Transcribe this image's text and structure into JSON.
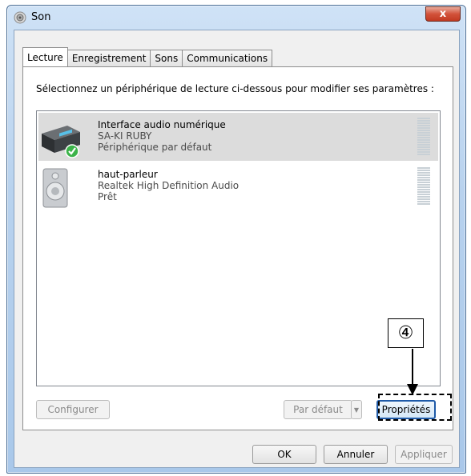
{
  "window": {
    "title": "Son",
    "close_label": "x"
  },
  "tabs": [
    {
      "label": "Lecture",
      "active": true
    },
    {
      "label": "Enregistrement",
      "active": false
    },
    {
      "label": "Sons",
      "active": false
    },
    {
      "label": "Communications",
      "active": false
    }
  ],
  "instruction": "Sélectionnez un périphérique de lecture ci-dessous pour modifier ses paramètres :",
  "devices": [
    {
      "name": "Interface audio numérique",
      "description": "SA-KI RUBY",
      "status": "Périphérique par défaut",
      "icon": "digital-audio-interface-icon",
      "selected": true,
      "default": true
    },
    {
      "name": "haut-parleur",
      "description": "Realtek High Definition Audio",
      "status": "Prêt",
      "icon": "speaker-icon",
      "selected": false,
      "default": false
    }
  ],
  "panel_buttons": {
    "configure": "Configurer",
    "set_default": "Par défaut",
    "properties": "Propriétés"
  },
  "dialog_buttons": {
    "ok": "OK",
    "cancel": "Annuler",
    "apply": "Appliquer"
  },
  "callout": {
    "label": "④"
  },
  "colors": {
    "selection": "#dcdcdc",
    "close_button": "#c23a22",
    "focus_border": "#1e5aa8"
  }
}
